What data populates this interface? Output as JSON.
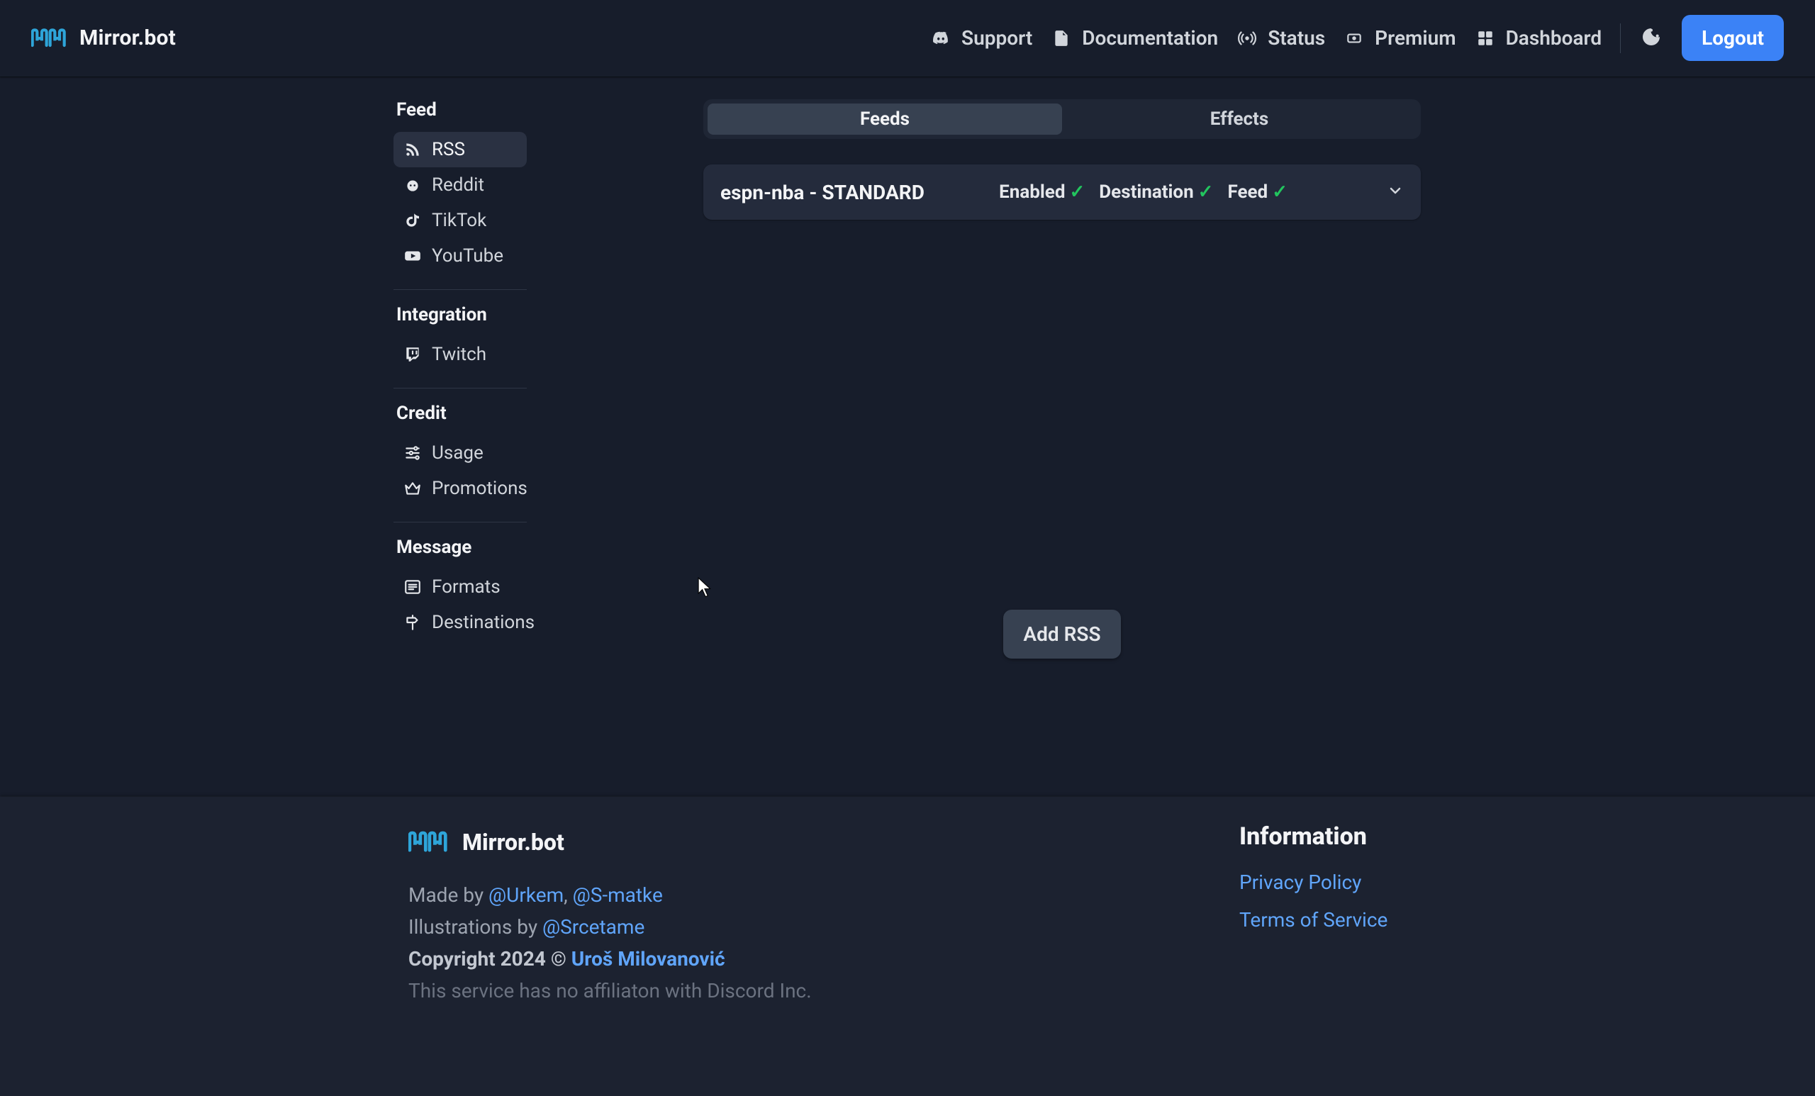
{
  "brand": {
    "name": "Mirror.bot"
  },
  "nav": {
    "support": "Support",
    "documentation": "Documentation",
    "status": "Status",
    "premium": "Premium",
    "dashboard": "Dashboard",
    "logout": "Logout"
  },
  "sidebar": {
    "sections": {
      "feed": {
        "title": "Feed",
        "items": [
          "RSS",
          "Reddit",
          "TikTok",
          "YouTube"
        ]
      },
      "integration": {
        "title": "Integration",
        "items": [
          "Twitch"
        ]
      },
      "credit": {
        "title": "Credit",
        "items": [
          "Usage",
          "Promotions"
        ]
      },
      "message": {
        "title": "Message",
        "items": [
          "Formats",
          "Destinations"
        ]
      }
    },
    "active": "RSS"
  },
  "tabs": {
    "feeds": "Feeds",
    "effects": "Effects",
    "active": "feeds"
  },
  "feed_card": {
    "title": "espn-nba - STANDARD",
    "statuses": [
      {
        "label": "Enabled",
        "ok": true
      },
      {
        "label": "Destination",
        "ok": true
      },
      {
        "label": "Feed",
        "ok": true
      }
    ]
  },
  "add_button_label": "Add RSS",
  "footer": {
    "brand": "Mirror.bot",
    "made_by_prefix": "Made by ",
    "made_by_link1": "@Urkem",
    "made_by_sep": ", ",
    "made_by_link2": "@S-matke",
    "illustrations_prefix": "Illustrations by ",
    "illustrations_link": "@Srcetame",
    "copyright_prefix": "Copyright 2024 © ",
    "copyright_link": "Uroš Milovanović",
    "disclaimer": "This service has no affiliaton with Discord Inc.",
    "info_title": "Information",
    "privacy": "Privacy Policy",
    "tos": "Terms of Service"
  },
  "colors": {
    "accent": "#3B82F6",
    "link": "#60A5FA",
    "ok": "#22C55E"
  }
}
